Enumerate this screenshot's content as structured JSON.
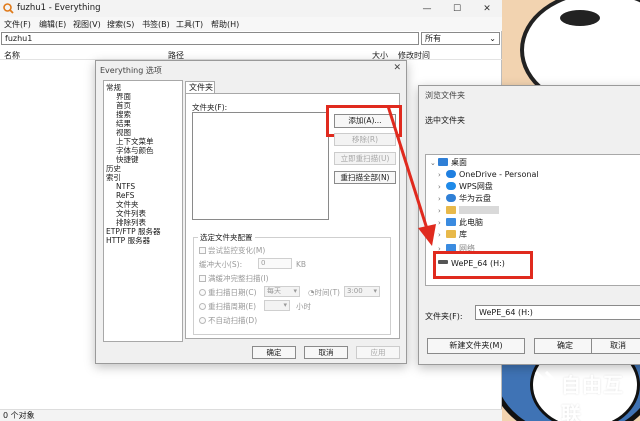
{
  "main_window": {
    "title": "fuzhu1 - Everything",
    "menu": [
      "文件(F)",
      "编辑(E)",
      "视图(V)",
      "搜索(S)",
      "书签(B)",
      "工具(T)",
      "帮助(H)"
    ],
    "search_value": "fuzhu1",
    "filter_value": "所有",
    "columns": [
      "名称",
      "路径",
      "大小",
      "修改时间"
    ],
    "status": "0 个对象"
  },
  "options_dialog": {
    "title": "Everything 选项",
    "tree": [
      "常规",
      "界面",
      "首页",
      "搜索",
      "结果",
      "视图",
      "上下文菜单",
      "字体与颜色",
      "快捷键",
      "历史",
      "索引",
      "NTFS",
      "ReFS",
      "文件夹",
      "文件列表",
      "排除列表",
      "ETP/FTP 服务器",
      "HTTP 服务器"
    ],
    "tab": "文件夹",
    "folder_label": "文件夹(F):",
    "buttons": {
      "add": "添加(A)...",
      "remove": "移除(R)",
      "rescan": "立即重扫描(U)",
      "rescan_all": "重扫描全部(N)"
    },
    "group_title": "选定文件夹配置",
    "monitor_label": "尝试监控变化(M)",
    "buffer_label": "缓冲大小(S):",
    "buffer_value": "0",
    "buffer_unit": "KB",
    "full_rescan_label": "满缓冲完整扫描(I)",
    "rescan_date_label": "重扫描日期(C)",
    "rescan_date_value": "每天",
    "time_label": "时间(T)",
    "time_value": "3:00",
    "rescan_period_label": "重扫描周期(E)",
    "hour_label": "小时",
    "no_auto_label": "不自动扫描(D)",
    "ok": "确定",
    "cancel": "取消",
    "apply": "应用"
  },
  "browse_dialog": {
    "title": "浏览文件夹",
    "prompt": "选中文件夹",
    "items": [
      {
        "label": "桌面",
        "icon": "desktop-icon",
        "color": "#2f7fd6"
      },
      {
        "label": "OneDrive - Personal",
        "icon": "cloud-icon",
        "color": "#1f7fe0"
      },
      {
        "label": "WPS网盘",
        "icon": "cloud-icon",
        "color": "#1f8ae8"
      },
      {
        "label": "华为云盘",
        "icon": "cloud-icon",
        "color": "#2f7fd6"
      },
      {
        "label": "",
        "icon": "folder-icon",
        "color": "#e8b94a"
      },
      {
        "label": "此电脑",
        "icon": "computer-icon",
        "color": "#3a8be0"
      },
      {
        "label": "库",
        "icon": "folder-icon",
        "color": "#e8b94a"
      },
      {
        "label": "网络",
        "icon": "network-icon",
        "color": "#3a8be0"
      },
      {
        "label": "WePE_64 (H:)",
        "icon": "drive-icon",
        "color": "#555555"
      }
    ],
    "folder_label": "文件夹(F):",
    "folder_value": "WePE_64 (H:)",
    "new_folder": "新建文件夹(M)",
    "ok": "确定",
    "cancel": "取消"
  },
  "watermark": "自由互联",
  "colors": {
    "highlight": "#e02a1e",
    "accent": "#0067c0"
  }
}
